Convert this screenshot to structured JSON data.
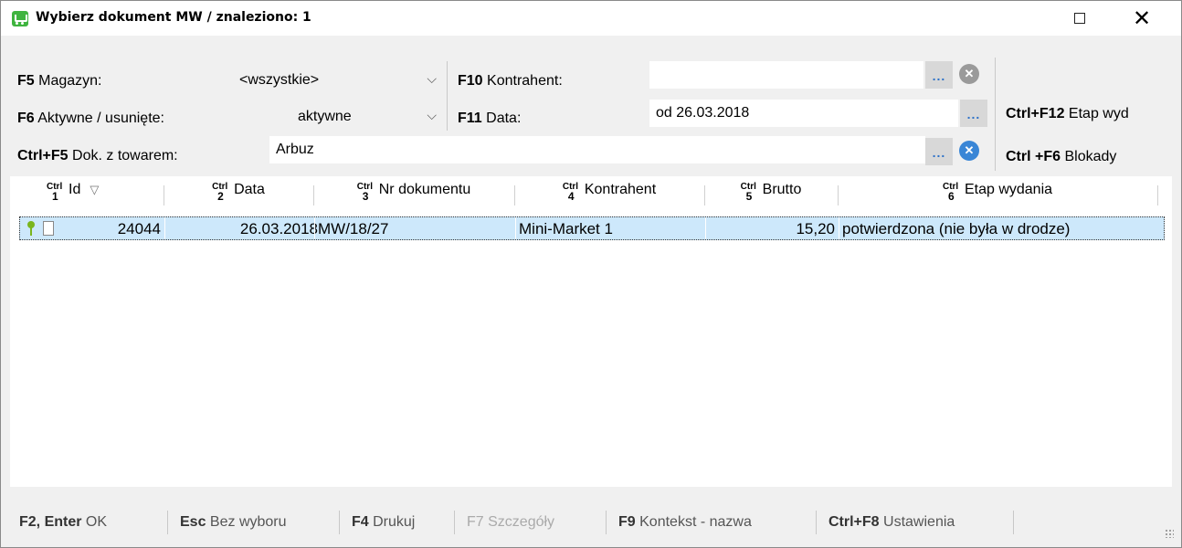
{
  "window": {
    "title": "Wybierz dokument MW / znaleziono: 1",
    "maximize_glyph": "□",
    "close_glyph": "✕"
  },
  "filters": {
    "magazyn": {
      "key": "F5",
      "label": "Magazyn:",
      "value": "<wszystkie>"
    },
    "aktywne": {
      "key": "F6",
      "label": "Aktywne / usunięte:",
      "value": "aktywne"
    },
    "dok_z_towarem": {
      "key": "Ctrl+F5",
      "label": "Dok. z towarem:",
      "value": "Arbuz"
    },
    "kontrahent": {
      "key": "F10",
      "label": "Kontrahent:",
      "value": ""
    },
    "data": {
      "key": "F11",
      "label": "Data:",
      "value": "od 26.03.2018"
    },
    "etap": {
      "key": "Ctrl+F12",
      "label": "Etap wyd"
    },
    "blokady": {
      "key": "Ctrl +F6",
      "label": "Blokady"
    },
    "dots_label": "...",
    "clear_glyph": "✕",
    "chevron_glyph": "⌵"
  },
  "table": {
    "ctrl_label": "Ctrl",
    "sort_glyph": "▽",
    "columns": [
      {
        "n": "1",
        "label": "Id"
      },
      {
        "n": "2",
        "label": "Data"
      },
      {
        "n": "3",
        "label": "Nr dokumentu"
      },
      {
        "n": "4",
        "label": "Kontrahent"
      },
      {
        "n": "5",
        "label": "Brutto"
      },
      {
        "n": "6",
        "label": "Etap wydania"
      }
    ],
    "rows": [
      {
        "id": "24044",
        "data": "26.03.2018",
        "nr_dokumentu": "MW/18/27",
        "kontrahent": "Mini-Market 1",
        "brutto": "15,20",
        "etap": "potwierdzona (nie była w drodze)"
      }
    ]
  },
  "statusbar": {
    "items": [
      {
        "key": "F2, Enter",
        "label": "OK",
        "enabled": true
      },
      {
        "key": "Esc",
        "label": "Bez wyboru",
        "enabled": true
      },
      {
        "key": "F4",
        "label": "Drukuj",
        "enabled": true
      },
      {
        "key": "F7",
        "label": "Szczegóły",
        "enabled": false
      },
      {
        "key": "F9",
        "label": "Kontekst - nazwa",
        "enabled": true
      },
      {
        "key": "Ctrl+F8",
        "label": "Ustawienia",
        "enabled": true
      }
    ]
  },
  "colors": {
    "selected_row": "#cde8fb",
    "app_icon": "#3fb43f",
    "dots_blue": "#2e72c8",
    "clear_blue": "#3a86d6"
  }
}
